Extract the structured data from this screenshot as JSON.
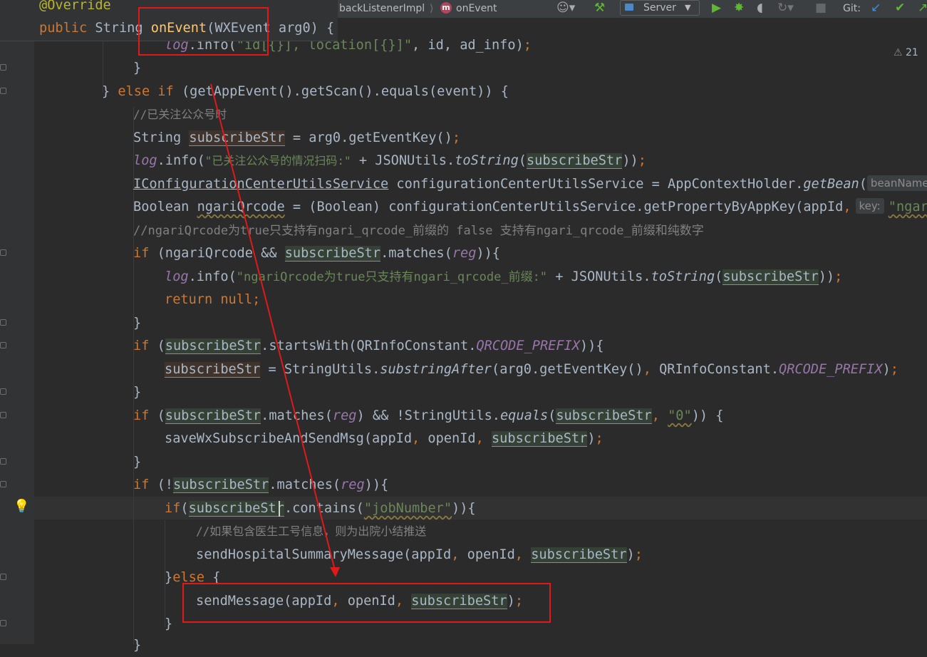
{
  "toolbar": {
    "breadcrumb_class": "backListenerImpl",
    "breadcrumb_sep": "⟩",
    "method_badge": "m",
    "breadcrumb_method": "onEvent",
    "run_config": "Server",
    "git_label": "Git:",
    "icons": [
      "user-icon",
      "hammer-icon",
      "run-icon",
      "debug-icon",
      "coverage-icon",
      "profile-icon",
      "stop-icon",
      "git-update-icon",
      "git-commit-icon",
      "git-push-icon"
    ]
  },
  "sticky": {
    "annotation": "@Override",
    "signature_kw": "public",
    "signature_type": "String",
    "method_name": "onEvent",
    "signature_rest": "(WXEvent arg0) {"
  },
  "inspection": {
    "warning_count": "21"
  },
  "code": {
    "l1": [
      "log",
      ".info(",
      "\"id[{}], location[{}]\"",
      ", id, ad_info)",
      ";"
    ],
    "l2": "}",
    "l3": [
      "} ",
      "else if ",
      "(getAppEvent().getScan().equals(event)) {"
    ],
    "l4": "//已关注公众号时",
    "l5": [
      "String ",
      "subscribeStr",
      " = arg0.getEventKey()",
      ";"
    ],
    "l6": [
      "log",
      ".info(",
      "\"已关注公众号的情况扫码:\"",
      " + JSONUtils.",
      "toString",
      "(",
      "subscribeStr",
      "))",
      ";"
    ],
    "l7": [
      "IConfigurationCenterUtilsService",
      " configurationCenterUtilsService = AppContextHolder.",
      "getBean",
      "(",
      "beanName:"
    ],
    "l8": [
      "Boolean ",
      "ngariQrcode",
      " = (Boolean) configurationCenterUtilsService.getPropertyByAppKey(appId",
      ",",
      "key:",
      "\"ngariQ"
    ],
    "l9": "//ngariQrcode为true只支持有ngari_qrcode_前缀的 false 支持有ngari_qrcode_前缀和纯数字",
    "l10": [
      "if ",
      "(ngariQrcode && ",
      "subscribeStr",
      ".matches(",
      "reg",
      ")){"
    ],
    "l11": [
      "log",
      ".info(",
      "\"ngariQrcode为true只支持有ngari_qrcode_前缀:\"",
      " + JSONUtils.",
      "toString",
      "(",
      "subscribeStr",
      "))",
      ";"
    ],
    "l12": [
      "return null",
      ";"
    ],
    "l13": "}",
    "l14": [
      "if ",
      "(",
      "subscribeStr",
      ".startsWith(QRInfoConstant.",
      "QRCODE_PREFIX",
      ")){"
    ],
    "l15": [
      "subscribeStr",
      " = StringUtils.",
      "substringAfter",
      "(arg0.getEventKey()",
      ", ",
      "QRInfoConstant.",
      "QRCODE_PREFIX",
      ")",
      ";"
    ],
    "l16": "}",
    "l17": [
      "if ",
      "(",
      "subscribeStr",
      ".matches(",
      "reg",
      ") && !StringUtils.",
      "equals",
      "(",
      "subscribeStr",
      ", ",
      "\"0\"",
      ")) {"
    ],
    "l18": [
      "saveWxSubscribeAndSendMsg(appId",
      ", ",
      "openId",
      ", ",
      "subscribeStr",
      ")",
      ";"
    ],
    "l19": "}",
    "l20": [
      "if ",
      "(!",
      "subscribeStr",
      ".matches(",
      "reg",
      ")){"
    ],
    "l21": [
      "if",
      "(",
      "subscribeStr",
      ".contains(",
      "\"jobNumber\"",
      ")){"
    ],
    "l22": "//如果包含医生工号信息，则为出院小结推送",
    "l23": [
      "sendHospitalSummaryMessage(appId",
      ", ",
      "openId",
      ", ",
      "subscribeStr",
      ")",
      ";"
    ],
    "l24": [
      "}",
      "else ",
      "{"
    ],
    "l25": [
      "sendMessage(appId",
      ", ",
      "openId",
      ", ",
      "subscribeStr",
      ")",
      ";"
    ],
    "l26": "}",
    "l27": "}"
  },
  "colors": {
    "editor_bg": "#2b2b2b",
    "keyword": "#cc7832",
    "string": "#6a8759",
    "comment": "#808080",
    "field": "#9876aa",
    "annotation": "#bbb529",
    "method_decl": "#ffc66d",
    "highlight_red": "#e0191b"
  }
}
